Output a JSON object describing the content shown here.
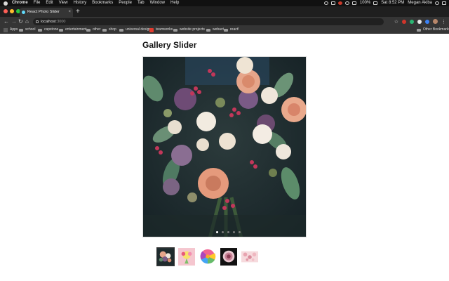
{
  "menubar": {
    "items": [
      "Chrome",
      "File",
      "Edit",
      "View",
      "History",
      "Bookmarks",
      "People",
      "Tab",
      "Window",
      "Help"
    ],
    "battery": "100%",
    "time": "Sat 8:52 PM",
    "user": "Megan Akiba"
  },
  "browser": {
    "tab_title": "React Photo Slider",
    "tab_close": "×",
    "new_tab": "+",
    "url_host": "localhost",
    "url_port": ":3000",
    "back": "←",
    "forward": "→",
    "reload": "↻",
    "home": "⌂",
    "star": "☆",
    "menu": "⋮"
  },
  "bookmarks": {
    "items": [
      "Apps",
      "school",
      "capstone",
      "entertainment",
      "other",
      "shop",
      "universal design",
      "teamworks",
      "website projects",
      "webact",
      "react!"
    ],
    "other": "Other Bookmarks"
  },
  "page": {
    "title": "Gallery Slider"
  },
  "slider": {
    "slide_count": 5,
    "active_index": 0
  },
  "thumbnails": [
    {
      "name": "bouquet-dark",
      "selected": true
    },
    {
      "name": "bouquet-pink",
      "selected": false
    },
    {
      "name": "daisy-rainbow",
      "selected": false
    },
    {
      "name": "dahlia-dark",
      "selected": false
    },
    {
      "name": "blossoms-pink",
      "selected": false
    }
  ],
  "colors": {
    "accent_chrome_dark": "#353535",
    "dot_active": "#ffffff",
    "dot_inactive": "#7a7a7a"
  }
}
